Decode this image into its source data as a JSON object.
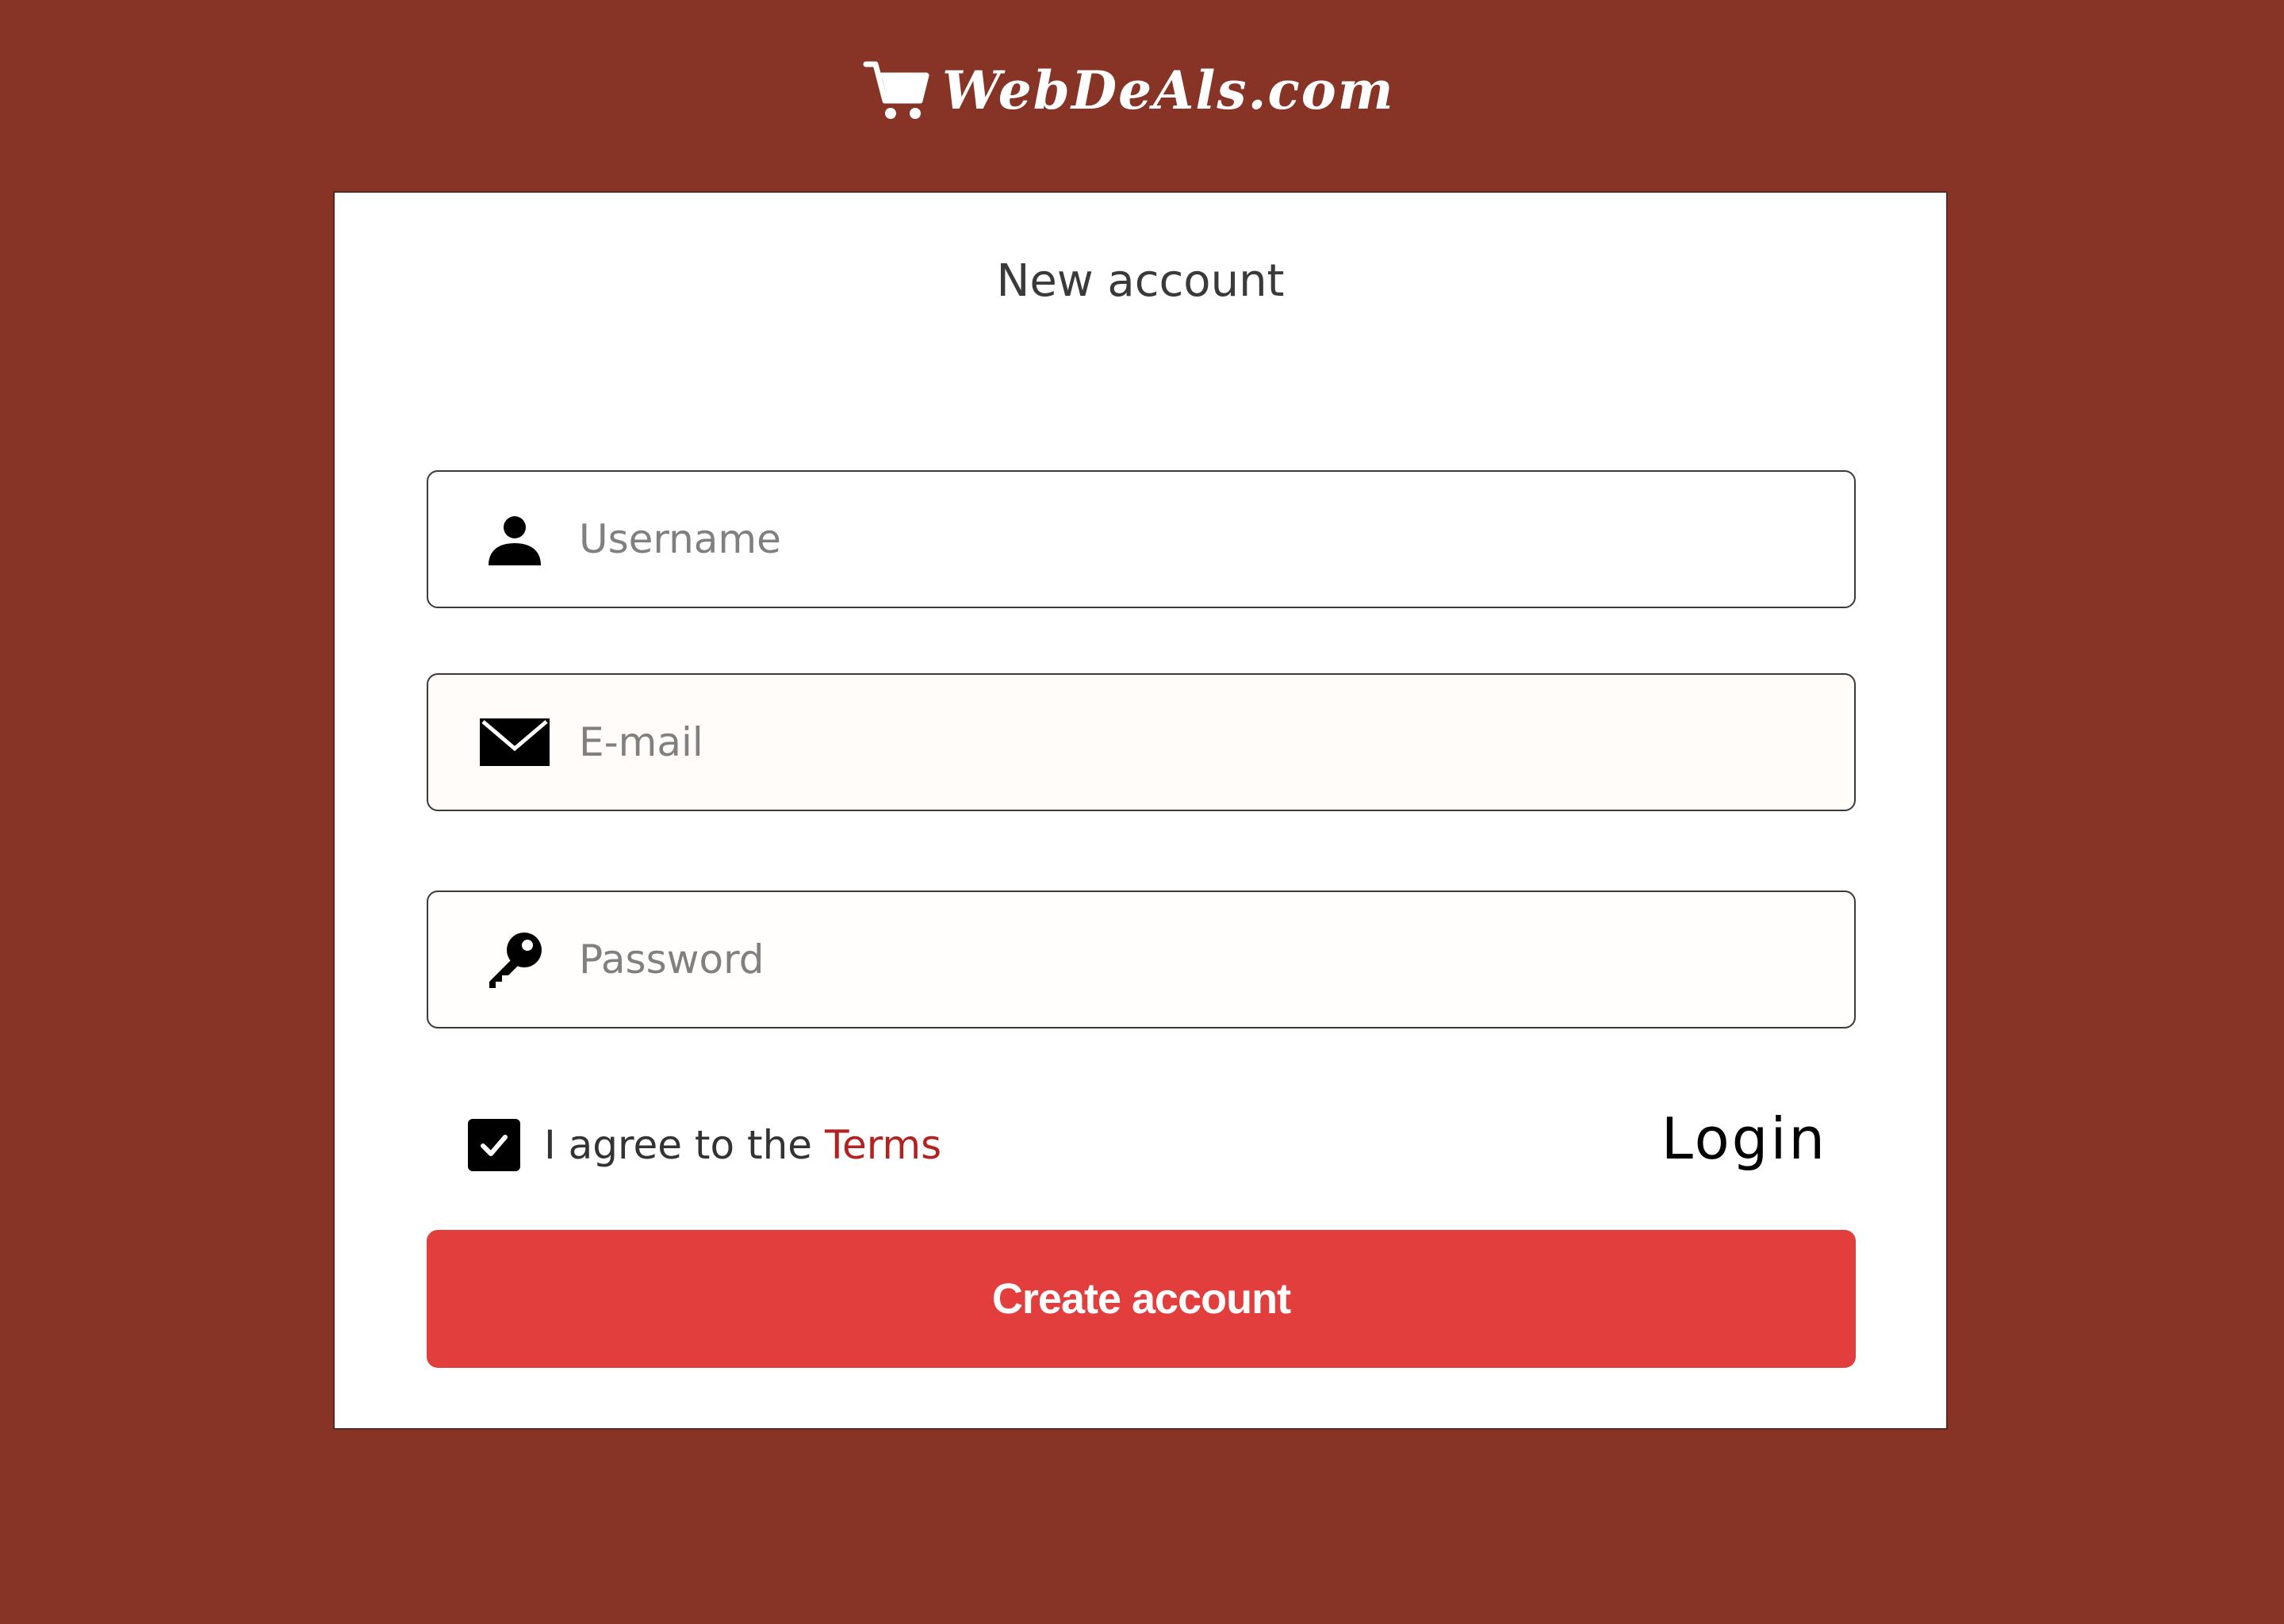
{
  "brand": {
    "name": "WebDeAls.com",
    "logo_icon": "shopping-cart-icon"
  },
  "form": {
    "title": "New account",
    "fields": {
      "username": {
        "placeholder": "Username",
        "value": "",
        "icon": "person-icon"
      },
      "email": {
        "placeholder": "E-mail",
        "value": "",
        "icon": "envelope-icon"
      },
      "password": {
        "placeholder": "Password",
        "value": "",
        "icon": "key-icon"
      }
    },
    "terms": {
      "checked": true,
      "prefix": "I agree to the ",
      "link_label": "Terms"
    },
    "login_label": "Login",
    "submit_label": "Create account"
  },
  "colors": {
    "background": "#873426",
    "card": "#ffffff",
    "primary_button": "#e23e3e",
    "link": "#b32121"
  }
}
